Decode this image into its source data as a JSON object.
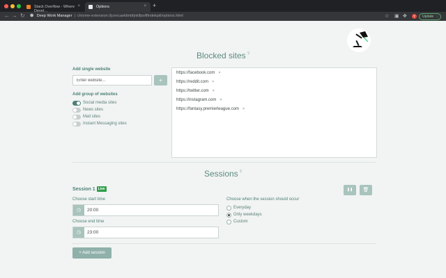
{
  "browser": {
    "tabs": [
      {
        "title": "Stack Overflow - Where Devel…",
        "active": false
      },
      {
        "title": "Options",
        "active": true
      }
    ],
    "extension_name": "Deep Work Manager",
    "url": "chrome-extension://jcencaeldmbfjnklfpoifflndekpiil/options.html",
    "avatar_letter": "T",
    "update_label": "Update",
    "colors": {
      "close": "#ff5f57",
      "minimize": "#febc2e",
      "maximize": "#28c840"
    }
  },
  "blocked": {
    "title": "Blocked sites",
    "add_single_label": "Add single website",
    "input_placeholder": "Enter website...",
    "add_button": "+",
    "add_group_label": "Add group of websites",
    "groups": [
      {
        "label": "Social media sites",
        "on": true
      },
      {
        "label": "News sites",
        "on": false
      },
      {
        "label": "Mail sites",
        "on": false
      },
      {
        "label": "Instant Messaging sites",
        "on": false
      }
    ],
    "sites": [
      "https://facebook.com",
      "https://reddit.com",
      "https://twitter.com",
      "https://instagram.com",
      "https://fantasy.premierleague.com"
    ],
    "remove_glyph": "×"
  },
  "sessions": {
    "title": "Sessions",
    "session_name": "Session 1",
    "live_badge": "Live",
    "start_label": "Choose start time",
    "start_value": "20:00",
    "end_label": "Choose end time",
    "end_value": "23:00",
    "when_label": "Choose when the session should occur",
    "options": [
      {
        "label": "Everyday",
        "selected": false
      },
      {
        "label": "Only weekdays",
        "selected": true
      },
      {
        "label": "Custom",
        "selected": false
      }
    ],
    "pause_glyph": "❚❚",
    "delete_glyph": "🗑",
    "add_session_label": "+ Add session"
  },
  "help_glyph": "?"
}
